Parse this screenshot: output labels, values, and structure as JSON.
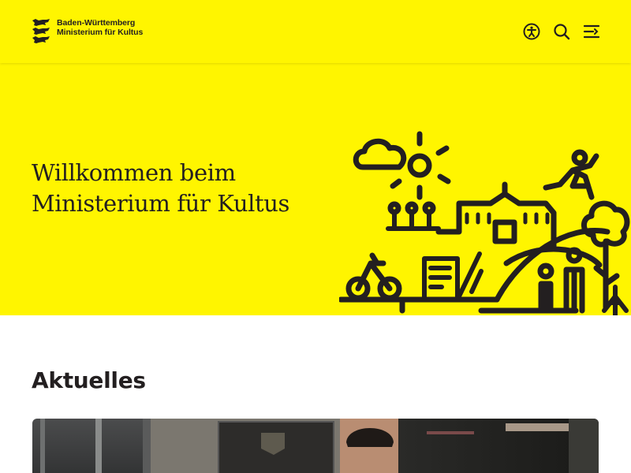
{
  "header": {
    "logo_line1": "Baden-Württemberg",
    "logo_line2": "Ministerium für Kultus",
    "accent_color": "#fff500",
    "icons": [
      "accessibility-icon",
      "search-icon",
      "menu-icon"
    ]
  },
  "hero": {
    "title_line1": "Willkommen beim",
    "title_line2": "Ministerium für Kultus",
    "illustration": "city-illustration"
  },
  "news": {
    "heading": "Aktuelles",
    "image": "news-photo"
  }
}
